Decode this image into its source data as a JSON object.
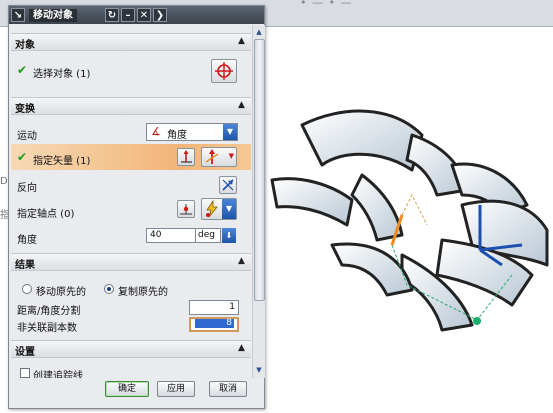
{
  "window": {
    "title": "移动对象",
    "background_title_ghost": "• — • —",
    "left_ghost_letters": [
      "D",
      "指"
    ]
  },
  "sections": {
    "object": {
      "header": "对象",
      "select_label": "选择对象 (1)"
    },
    "transform": {
      "header": "变换",
      "motion_label": "运动",
      "motion_value": "角度",
      "vector_label": "指定矢量 (1)",
      "reverse_label": "反向",
      "axis_point_label": "指定轴点 (0)",
      "angle_label": "角度",
      "angle_value": "40",
      "angle_unit": "deg"
    },
    "result": {
      "header": "结果",
      "move_original": "移动原先的",
      "copy_original": "复制原先的",
      "selected": "copy_original",
      "distance_split_label": "距离/角度分割",
      "distance_split_value": "1",
      "non_assoc_copies_label": "非关联副本数",
      "non_assoc_copies_value": "8"
    },
    "settings": {
      "header": "设置",
      "create_trace_label": "创建追踪线",
      "create_trace_checked": false
    }
  },
  "buttons": {
    "ok": "确定",
    "apply": "应用",
    "cancel": "取消"
  },
  "colors": {
    "highlight_row": "#f2b579",
    "check_green": "#1a9a1a",
    "vector_blue": "#1d4fb0",
    "vector_orange": "#f08a1c"
  }
}
